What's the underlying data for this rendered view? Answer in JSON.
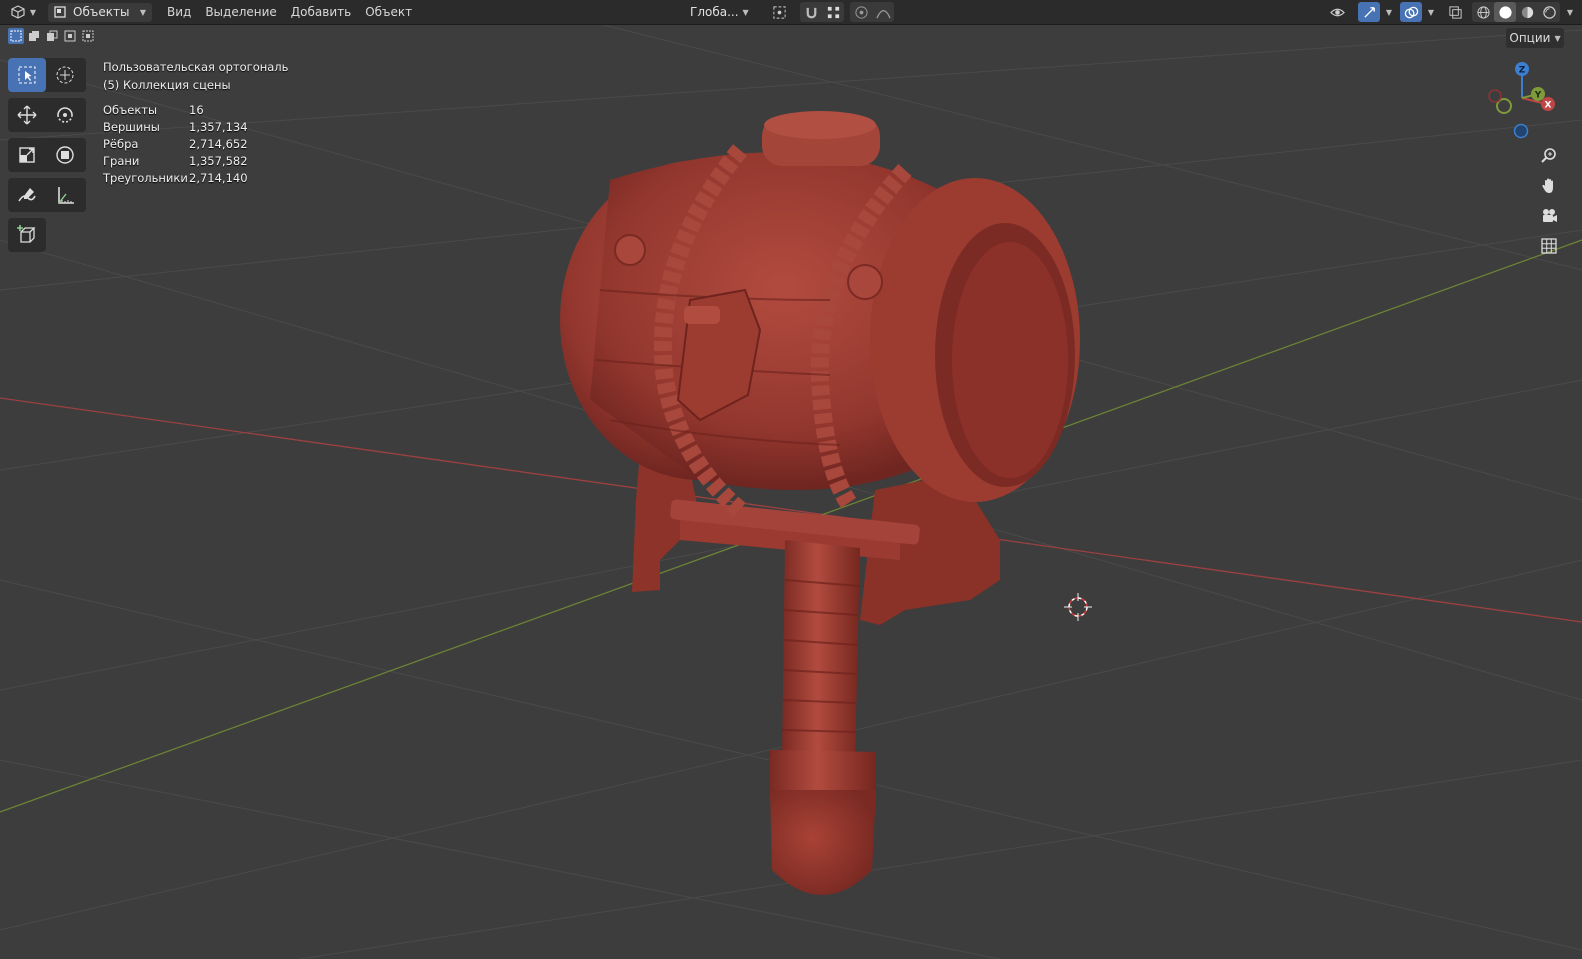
{
  "header": {
    "mode_label": "Объекты",
    "menus": [
      "Вид",
      "Выделение",
      "Добавить",
      "Объект"
    ],
    "transform_orientation": "Глоба...",
    "options_label": "Опции"
  },
  "overlay": {
    "view_name": "Пользовательская ортогональ",
    "collection": "(5) Коллекция сцены",
    "stats": [
      {
        "label": "Объекты",
        "value": "16"
      },
      {
        "label": "Вершины",
        "value": "1,357,134"
      },
      {
        "label": "Рёбра",
        "value": "2,714,652"
      },
      {
        "label": "Грани",
        "value": "1,357,582"
      },
      {
        "label": "Треугольники",
        "value": "2,714,140"
      }
    ]
  },
  "gizmo": {
    "x_label": "X",
    "y_label": "Y",
    "z_label": "Z"
  },
  "colors": {
    "viewport_bg": "#3d3d3d",
    "header_bg": "#2b2b2b",
    "accent": "#4772b3",
    "model": "#9a3d33",
    "axis_x": "#c04545",
    "axis_y": "#7e9a3a",
    "axis_z": "#3a7fd0"
  },
  "icons": {
    "editor_type": "view3d-icon",
    "tools": [
      "select-box-icon",
      "cursor-icon",
      "move-icon",
      "rotate-icon",
      "scale-icon",
      "transform-icon",
      "annotate-icon",
      "measure-icon",
      "add-cube-icon"
    ],
    "nav": [
      "zoom-icon",
      "hand-pan-icon",
      "camera-icon",
      "grid-ortho-icon"
    ]
  }
}
